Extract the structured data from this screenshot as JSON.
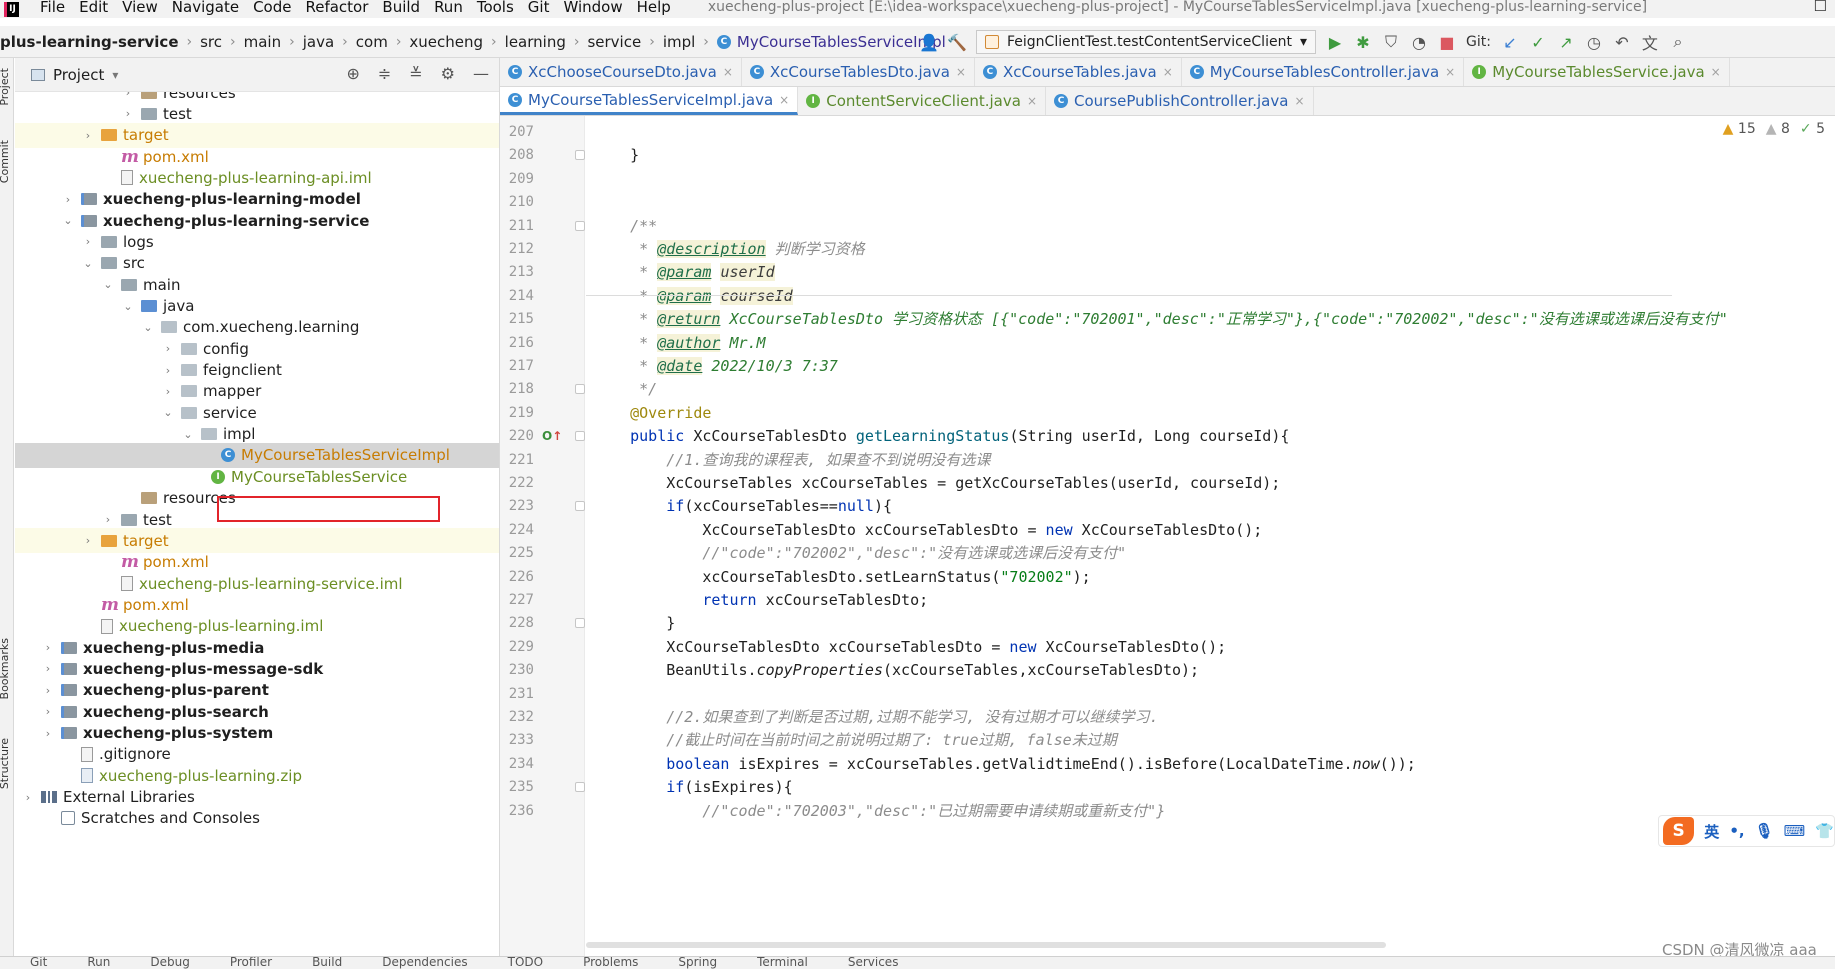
{
  "menubar": {
    "app_logo": "IJ",
    "items": [
      "File",
      "Edit",
      "View",
      "Navigate",
      "Code",
      "Refactor",
      "Build",
      "Run",
      "Tools",
      "Git",
      "Window",
      "Help"
    ],
    "window_title": "xuecheng-plus-project [E:\\idea-workspace\\xuecheng-plus-project] - MyCourseTablesServiceImpl.java [xuecheng-plus-learning-service]",
    "window_control": "☐"
  },
  "navbar": {
    "breadcrumbs": [
      "plus-learning-service",
      "src",
      "main",
      "java",
      "com",
      "xuecheng",
      "learning",
      "service",
      "impl",
      "MyCourseTablesServiceImpl"
    ],
    "run_config": "FeignClientTest.testContentServiceClient",
    "git_label": "Git:"
  },
  "left_stripe": {
    "top_labels": [
      "Project",
      "Commit"
    ],
    "bottom_labels": [
      "Bookmarks",
      "Structure"
    ]
  },
  "project_panel": {
    "title": "Project",
    "tree": [
      {
        "label": "resources",
        "icon": "folder-res",
        "arrow": "›",
        "style": ""
      },
      {
        "label": "test",
        "icon": "folder",
        "arrow": "›",
        "style": ""
      },
      {
        "label": "target",
        "icon": "folder-orange",
        "arrow": "›",
        "style": "orange",
        "bg": "yellow"
      },
      {
        "label": "pom.xml",
        "icon": "maven",
        "arrow": "",
        "style": "orange"
      },
      {
        "label": "xuecheng-plus-learning-api.iml",
        "icon": "file",
        "arrow": "",
        "style": "green"
      },
      {
        "label": "xuecheng-plus-learning-model",
        "icon": "module",
        "arrow": "›",
        "style": "bold"
      },
      {
        "label": "xuecheng-plus-learning-service",
        "icon": "module",
        "arrow": "⌄",
        "style": "bold"
      },
      {
        "label": "logs",
        "icon": "folder",
        "arrow": "›",
        "style": ""
      },
      {
        "label": "src",
        "icon": "folder",
        "arrow": "⌄",
        "style": ""
      },
      {
        "label": "main",
        "icon": "folder",
        "arrow": "⌄",
        "style": ""
      },
      {
        "label": "java",
        "icon": "folder-blue",
        "arrow": "⌄",
        "style": ""
      },
      {
        "label": "com.xuecheng.learning",
        "icon": "package",
        "arrow": "⌄",
        "style": ""
      },
      {
        "label": "config",
        "icon": "package",
        "arrow": "›",
        "style": ""
      },
      {
        "label": "feignclient",
        "icon": "package",
        "arrow": "›",
        "style": ""
      },
      {
        "label": "mapper",
        "icon": "package",
        "arrow": "›",
        "style": ""
      },
      {
        "label": "service",
        "icon": "package",
        "arrow": "⌄",
        "style": ""
      },
      {
        "label": "impl",
        "icon": "package",
        "arrow": "⌄",
        "style": ""
      },
      {
        "label": "MyCourseTablesServiceImpl",
        "icon": "class",
        "arrow": "",
        "style": "orange",
        "bg": "selected"
      },
      {
        "label": "MyCourseTablesService",
        "icon": "interface",
        "arrow": "",
        "style": "green"
      },
      {
        "label": "resources",
        "icon": "folder-res",
        "arrow": "",
        "style": ""
      },
      {
        "label": "test",
        "icon": "folder",
        "arrow": "›",
        "style": ""
      },
      {
        "label": "target",
        "icon": "folder-orange",
        "arrow": "›",
        "style": "orange",
        "bg": "yellow"
      },
      {
        "label": "pom.xml",
        "icon": "maven",
        "arrow": "",
        "style": "orange"
      },
      {
        "label": "xuecheng-plus-learning-service.iml",
        "icon": "file",
        "arrow": "",
        "style": "green"
      },
      {
        "label": "pom.xml",
        "icon": "maven",
        "arrow": "",
        "style": "orange"
      },
      {
        "label": "xuecheng-plus-learning.iml",
        "icon": "file",
        "arrow": "",
        "style": "green"
      },
      {
        "label": "xuecheng-plus-media",
        "icon": "module",
        "arrow": "›",
        "style": "bold"
      },
      {
        "label": "xuecheng-plus-message-sdk",
        "icon": "module",
        "arrow": "›",
        "style": "bold"
      },
      {
        "label": "xuecheng-plus-parent",
        "icon": "module",
        "arrow": "›",
        "style": "bold"
      },
      {
        "label": "xuecheng-plus-search",
        "icon": "module",
        "arrow": "›",
        "style": "bold"
      },
      {
        "label": "xuecheng-plus-system",
        "icon": "module",
        "arrow": "›",
        "style": "bold"
      },
      {
        "label": ".gitignore",
        "icon": "file",
        "arrow": "",
        "style": ""
      },
      {
        "label": "xuecheng-plus-learning.zip",
        "icon": "zip",
        "arrow": "",
        "style": "green"
      },
      {
        "label": "External Libraries",
        "icon": "library",
        "arrow": "›",
        "style": ""
      },
      {
        "label": "Scratches and Consoles",
        "icon": "scratch",
        "arrow": "",
        "style": ""
      }
    ]
  },
  "editor": {
    "tabs_row1": [
      {
        "label": "XcChooseCourseDto.java",
        "kind": "class"
      },
      {
        "label": "XcCourseTablesDto.java",
        "kind": "class"
      },
      {
        "label": "XcCourseTables.java",
        "kind": "class"
      },
      {
        "label": "MyCourseTablesController.java",
        "kind": "class"
      },
      {
        "label": "MyCourseTablesService.java",
        "kind": "interface"
      }
    ],
    "tabs_row2": [
      {
        "label": "MyCourseTablesServiceImpl.java",
        "kind": "class",
        "active": true
      },
      {
        "label": "ContentServiceClient.java",
        "kind": "interface"
      },
      {
        "label": "CoursePublishController.java",
        "kind": "class"
      }
    ],
    "inspections": {
      "warnings": "15",
      "weak_warnings": "8",
      "ok": "5"
    },
    "code_lines": [
      {
        "n": "207",
        "html": ""
      },
      {
        "n": "208",
        "html": "    }"
      },
      {
        "n": "209",
        "html": ""
      },
      {
        "n": "210",
        "html": ""
      },
      {
        "n": "211",
        "html": "    <span class='doc'>/**</span>"
      },
      {
        "n": "212",
        "html": "<span class='doc'>     * </span><span class='doctag'>@description</span><span class='doc'> 判断学习资格</span>"
      },
      {
        "n": "213",
        "html": "<span class='doc'>     * </span><span class='doctag'>@param</span><span class='doc'> </span><span class='docval'>userId</span>"
      },
      {
        "n": "214",
        "html": "<span class='doc'>     * </span><span class='doctag'>@param</span><span class='doc'> </span><span class='docval'>courseId</span>"
      },
      {
        "n": "215",
        "html": "<span class='doc'>     * </span><span class='doctag'>@return</span><span class='docg'> XcCourseTablesDto 学习资格状态 [{\"code\":\"702001\",\"desc\":\"正常学习\"},{\"code\":\"702002\",\"desc\":\"没有选课或选课后没有支付\"</span>"
      },
      {
        "n": "216",
        "html": "<span class='doc'>     * </span><span class='doctag'>@author</span><span class='docg'> Mr.M</span>"
      },
      {
        "n": "217",
        "html": "<span class='doc'>     * </span><span class='doctag'>@date</span><span class='docg'> 2022/10/3 7:37</span>"
      },
      {
        "n": "218",
        "html": "<span class='doc'>     */</span>"
      },
      {
        "n": "219",
        "html": "    <span class='ann'>@Override</span>"
      },
      {
        "n": "220",
        "html": "    <span class='kw'>public</span> XcCourseTablesDto <span class='fn'>getLearningStatus</span>(String userId, Long courseId){"
      },
      {
        "n": "221",
        "html": "        <span class='cmt'>//1.查询我的课程表, 如果查不到说明没有选课</span>"
      },
      {
        "n": "222",
        "html": "        XcCourseTables xcCourseTables = getXcCourseTables(userId, courseId);"
      },
      {
        "n": "223",
        "html": "        <span class='kw'>if</span>(xcCourseTables==<span class='kw'>null</span>){"
      },
      {
        "n": "224",
        "html": "            XcCourseTablesDto xcCourseTablesDto = <span class='kw'>new</span> XcCourseTablesDto();"
      },
      {
        "n": "225",
        "html": "            <span class='cmt'>//\"code\":\"702002\",\"desc\":\"没有选课或选课后没有支付\"</span>"
      },
      {
        "n": "226",
        "html": "            xcCourseTablesDto.setLearnStatus(<span class='str'>\"702002\"</span>);"
      },
      {
        "n": "227",
        "html": "            <span class='kw'>return</span> xcCourseTablesDto;"
      },
      {
        "n": "228",
        "html": "        }"
      },
      {
        "n": "229",
        "html": "        XcCourseTablesDto xcCourseTablesDto = <span class='kw'>new</span> XcCourseTablesDto();"
      },
      {
        "n": "230",
        "html": "        BeanUtils.<span class='istatic'>copyProperties</span>(xcCourseTables,xcCourseTablesDto);"
      },
      {
        "n": "231",
        "html": ""
      },
      {
        "n": "232",
        "html": "        <span class='cmt'>//2.如果查到了判断是否过期,过期不能学习, 没有过期才可以继续学习.</span>"
      },
      {
        "n": "233",
        "html": "        <span class='cmt'>//截止时间在当前时间之前说明过期了: true过期, false未过期</span>"
      },
      {
        "n": "234",
        "html": "        <span class='kw'>boolean</span> isExpires = xcCourseTables.getValidtimeEnd().isBefore(LocalDateTime.<span class='istatic'>now</span>());"
      },
      {
        "n": "235",
        "html": "        <span class='kw'>if</span>(isExpires){"
      },
      {
        "n": "236",
        "html": "            <span class='cmt'>//\"code\":\"702003\",\"desc\":\"已过期需要申请续期或重新支付\"}</span>"
      }
    ]
  },
  "ime": {
    "lang": "英",
    "punct": "•,"
  },
  "watermark": "CSDN @清风微凉 aaa",
  "bottombar": {
    "items": [
      "Git",
      "Run",
      "Debug",
      "Profiler",
      "Build",
      "Dependencies",
      "TODO",
      "Problems",
      "Spring",
      "Terminal",
      "Services"
    ]
  }
}
